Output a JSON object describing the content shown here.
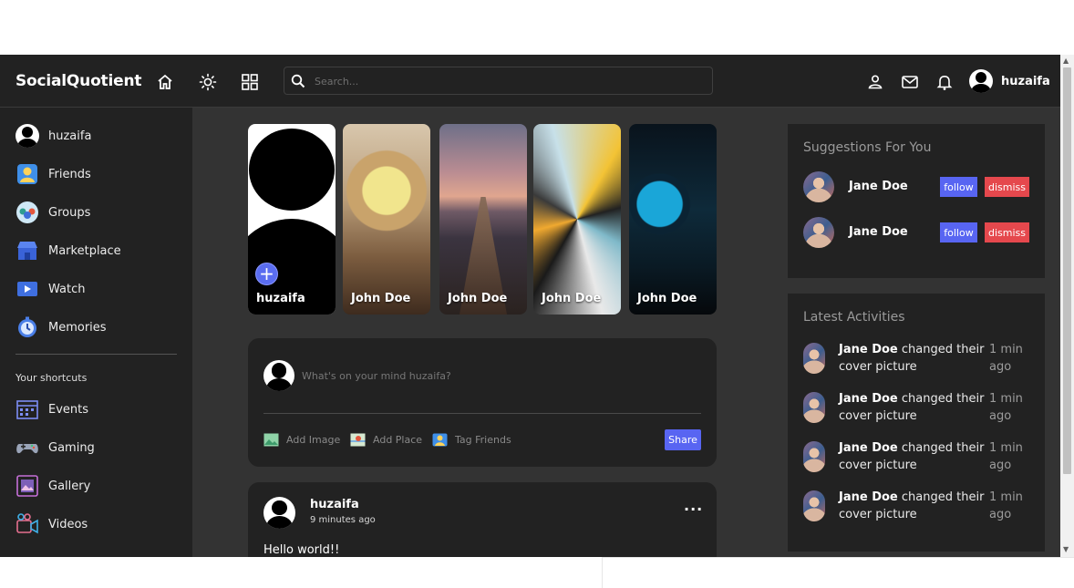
{
  "navbar": {
    "logo": "SocialQuotient",
    "search_placeholder": "Search...",
    "user_name": "huzaifa",
    "icons": [
      "home-icon",
      "sun-icon",
      "grid-icon",
      "search-icon",
      "person-icon",
      "mail-icon",
      "bell-icon"
    ]
  },
  "sidebar": {
    "items": [
      {
        "label": "huzaifa",
        "icon": "avatar"
      },
      {
        "label": "Friends",
        "icon": "friends-icon"
      },
      {
        "label": "Groups",
        "icon": "groups-icon"
      },
      {
        "label": "Marketplace",
        "icon": "marketplace-icon"
      },
      {
        "label": "Watch",
        "icon": "watch-icon"
      },
      {
        "label": "Memories",
        "icon": "memories-icon"
      }
    ],
    "shortcuts_title": "Your shortcuts",
    "shortcuts": [
      {
        "label": "Events",
        "icon": "events-icon"
      },
      {
        "label": "Gaming",
        "icon": "gaming-icon"
      },
      {
        "label": "Gallery",
        "icon": "gallery-icon"
      },
      {
        "label": "Videos",
        "icon": "videos-icon"
      }
    ]
  },
  "stories": [
    {
      "name": "huzaifa",
      "own": true
    },
    {
      "name": "John Doe"
    },
    {
      "name": "John Doe"
    },
    {
      "name": "John Doe"
    },
    {
      "name": "John Doe"
    }
  ],
  "composer": {
    "placeholder": "What's on your mind huzaifa?",
    "actions": [
      "Add Image",
      "Add Place",
      "Tag Friends"
    ],
    "share_label": "Share"
  },
  "post": {
    "author": "huzaifa",
    "time": "9 minutes ago",
    "more": "···",
    "text": "Hello world!!"
  },
  "suggestions": {
    "title": "Suggestions For You",
    "users": [
      {
        "name": "Jane Doe",
        "follow": "follow",
        "dismiss": "dismiss"
      },
      {
        "name": "Jane Doe",
        "follow": "follow",
        "dismiss": "dismiss"
      }
    ]
  },
  "activities": {
    "title": "Latest Activities",
    "items": [
      {
        "name": "Jane Doe",
        "action": "changed their cover picture",
        "time": "1 min ago"
      },
      {
        "name": "Jane Doe",
        "action": "changed their cover picture",
        "time": "1 min ago"
      },
      {
        "name": "Jane Doe",
        "action": "changed their cover picture",
        "time": "1 min ago"
      },
      {
        "name": "Jane Doe",
        "action": "changed their cover picture",
        "time": "1 min ago"
      }
    ]
  },
  "colors": {
    "accent": "#5865f2",
    "danger": "#e5484d",
    "panel": "#222222",
    "background": "#333333"
  }
}
